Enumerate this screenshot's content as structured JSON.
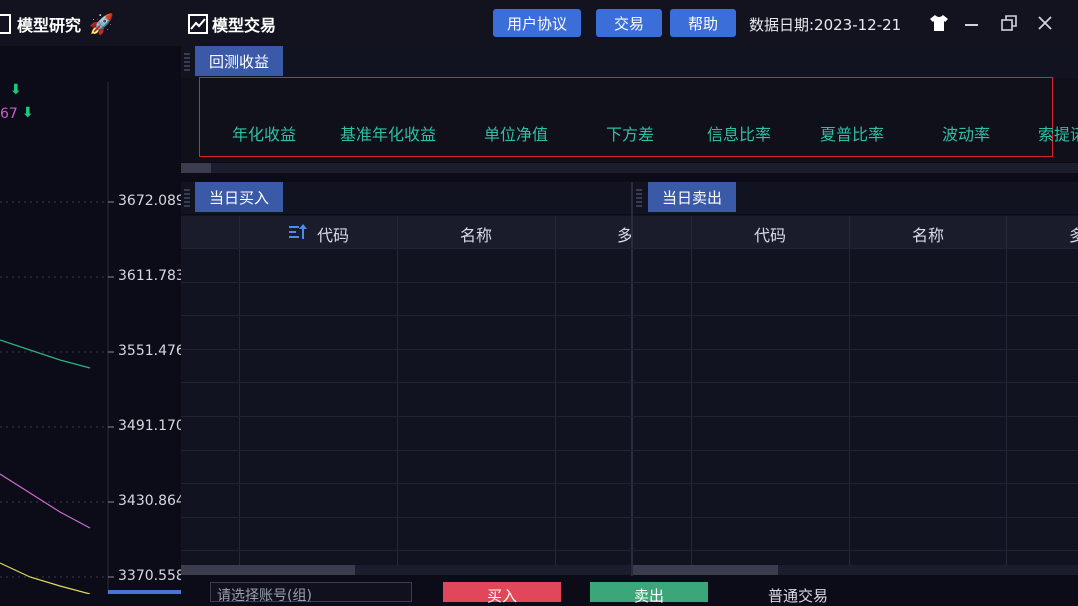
{
  "header": {
    "tab_model_research": "模型研究",
    "tab_model_trade": "模型交易",
    "buttons": {
      "user_agreement": "用户协议",
      "trade": "交易",
      "help": "帮助"
    },
    "data_date": "数据日期:2023-12-21"
  },
  "left_chart": {
    "y_labels": [
      "3672.089",
      "3611.783",
      "3551.476",
      "3491.170",
      "3430.864",
      "3370.558"
    ],
    "partial_value": "67"
  },
  "backtest": {
    "tab_label": "回测收益",
    "metrics": [
      "年化收益",
      "基准年化收益",
      "单位净值",
      "下方差",
      "信息比率",
      "夏普比率",
      "波动率",
      "索提诺"
    ]
  },
  "buy_panel": {
    "tab_label": "当日买入",
    "columns": [
      "代码",
      "名称",
      "多"
    ]
  },
  "sell_panel": {
    "tab_label": "当日卖出",
    "columns": [
      "代码",
      "名称",
      "多"
    ]
  },
  "bottom": {
    "account_placeholder": "请选择账号(组)",
    "buy_label": "买入",
    "sell_label": "卖出",
    "normal_trade_label": "普通交易"
  },
  "colors": {
    "accent_tab": "#3a5aa8",
    "button_blue": "#3b6ed8",
    "metric_teal": "#2fbfa5",
    "highlight_red": "#d6262b",
    "buy_red": "#e2465a",
    "sell_green": "#3aa67a"
  }
}
